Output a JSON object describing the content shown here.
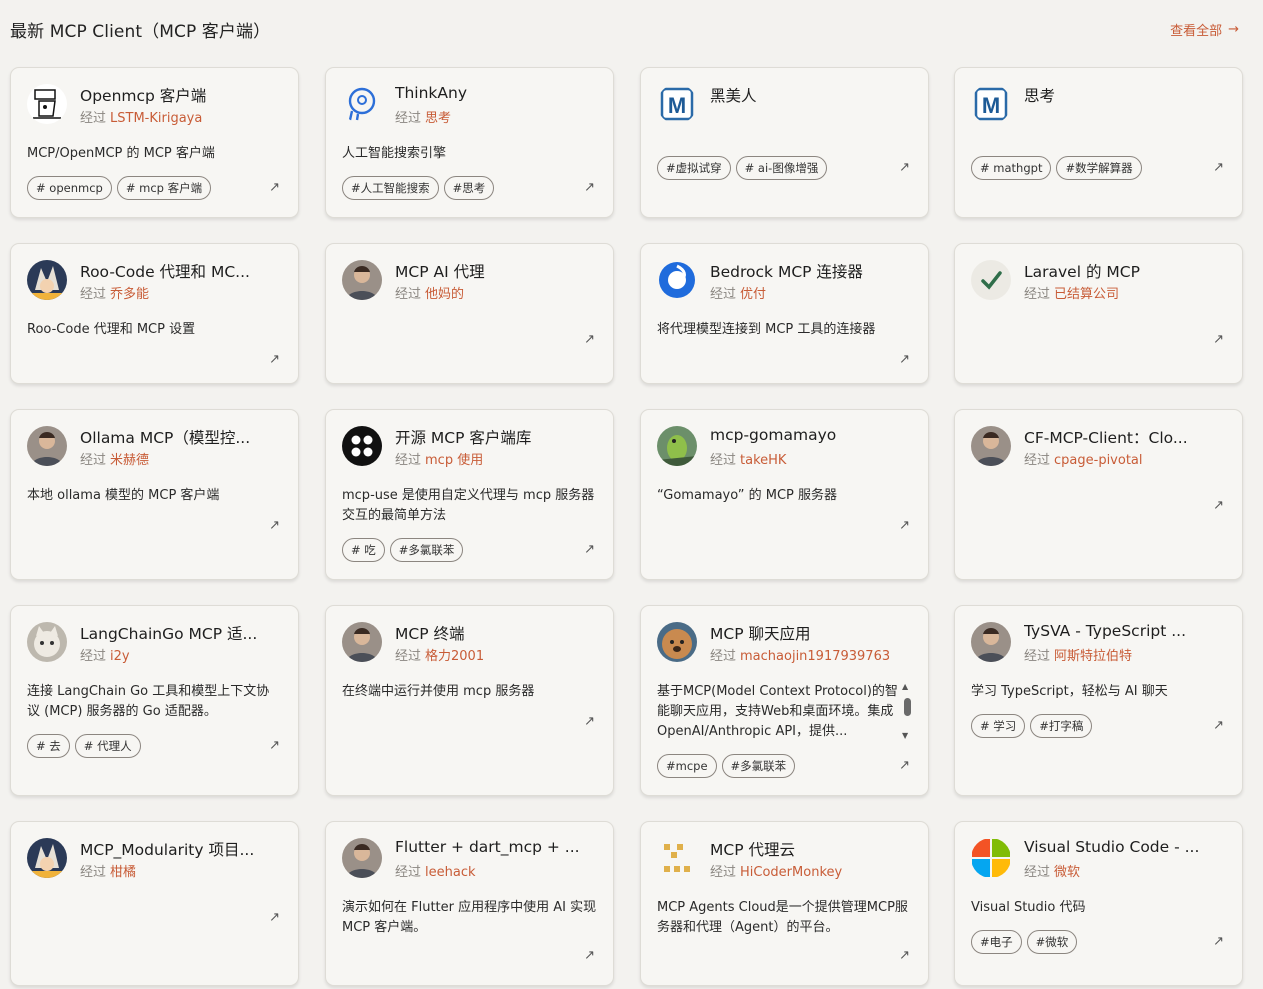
{
  "header": {
    "title": "最新 MCP Client（MCP 客户端）",
    "view_all": "查看全部",
    "accent": "#c85c37"
  },
  "by_label": "经过",
  "cards": [
    {
      "title": "Openmcp 客户端",
      "author": "LSTM-Kirigaya",
      "desc": "MCP/OpenMCP 的 MCP 客户端",
      "tags": [
        "# openmcp",
        "# mcp 客户端"
      ],
      "icon": "sketch-avatar-icon"
    },
    {
      "title": "ThinkAny",
      "author": "思考",
      "desc": "人工智能搜索引擎",
      "tags": [
        "#人工智能搜索",
        "#思考"
      ],
      "icon": "head-outline-icon"
    },
    {
      "title": "黑美人",
      "author": "",
      "desc": "",
      "tags": [
        "#虚拟试穿",
        "# ai-图像增强"
      ],
      "icon": "m-logo-icon"
    },
    {
      "title": "思考",
      "author": "",
      "desc": "",
      "tags": [
        "# mathgpt",
        "#数学解算器"
      ],
      "icon": "m-logo-icon"
    },
    {
      "title": "Roo-Code 代理和 MC...",
      "author": "乔多能",
      "desc": "Roo-Code 代理和 MCP 设置",
      "tags": [],
      "icon": "anime-avatar-icon"
    },
    {
      "title": "MCP AI 代理",
      "author": "他妈的",
      "desc": "",
      "tags": [],
      "icon": "user-photo-icon"
    },
    {
      "title": "Bedrock MCP 连接器",
      "author": "优付",
      "desc": "将代理模型连接到 MCP 工具的连接器",
      "tags": [],
      "icon": "blue-swirl-icon"
    },
    {
      "title": "Laravel 的 MCP",
      "author": "已结算公司",
      "desc": "",
      "tags": [],
      "icon": "check-logo-icon"
    },
    {
      "title": "Ollama MCP（模型控...",
      "author": "米赫德",
      "desc": "本地 ollama 模型的 MCP 客户端",
      "tags": [],
      "icon": "user-photo-icon"
    },
    {
      "title": "开源 MCP 客户端库",
      "author": "mcp 使用",
      "desc": "mcp-use 是使用自定义代理与 mcp 服务器交互的最简单方法",
      "tags": [
        "# 吃",
        "#多氯联苯"
      ],
      "icon": "dots-logo-icon"
    },
    {
      "title": "mcp-gomamayo",
      "author": "takeHK",
      "desc": "“Gomamayo” 的 MCP 服务器",
      "tags": [],
      "icon": "bird-photo-icon"
    },
    {
      "title": "CF-MCP-Client：Clo...",
      "author": "cpage-pivotal",
      "desc": "",
      "tags": [],
      "icon": "user-photo-icon"
    },
    {
      "title": "LangChainGo MCP 适...",
      "author": "i2y",
      "desc": "连接 LangChain Go 工具和模型上下文协议 (MCP) 服务器的 Go 适配器。",
      "tags": [
        "# 去",
        "# 代理人"
      ],
      "icon": "cat-photo-icon"
    },
    {
      "title": "MCP 终端",
      "author": "格力2001",
      "desc": "在终端中运行并使用 mcp 服务器",
      "tags": [],
      "icon": "user-photo-icon"
    },
    {
      "title": "MCP 聊天应用",
      "author": "machaojin1917939763",
      "desc": "基于MCP(Model Context Protocol)的智能聊天应用，支持Web和桌面环境。集成OpenAI/Anthropic API，提供...",
      "tags": [
        "#mcpe",
        "#多氯联苯"
      ],
      "icon": "dog-photo-icon"
    },
    {
      "title": "TySVA - TypeScript ...",
      "author": "阿斯特拉伯特",
      "desc": "学习 TypeScript，轻松与 AI 聊天",
      "tags": [
        "# 学习",
        "#打字稿"
      ],
      "icon": "user-photo-icon"
    },
    {
      "title": "MCP_Modularity 项目...",
      "author": "柑橘",
      "desc": "",
      "tags": [],
      "icon": "anime-avatar-icon"
    },
    {
      "title": "Flutter + dart_mcp + ...",
      "author": "leehack",
      "desc": "演示如何在 Flutter 应用程序中使用 AI 实现 MCP 客户端。",
      "tags": [],
      "icon": "user-photo-icon"
    },
    {
      "title": "MCP 代理云",
      "author": "HiCoderMonkey",
      "desc": "MCP Agents Cloud是一个提供管理MCP服务器和代理（Agent）的平台。",
      "tags": [],
      "icon": "pixel-logo-icon"
    },
    {
      "title": "Visual Studio Code - ...",
      "author": "微软",
      "desc": "Visual Studio 代码",
      "tags": [
        "#电子",
        "#微软"
      ],
      "icon": "microsoft-logo-icon"
    }
  ]
}
